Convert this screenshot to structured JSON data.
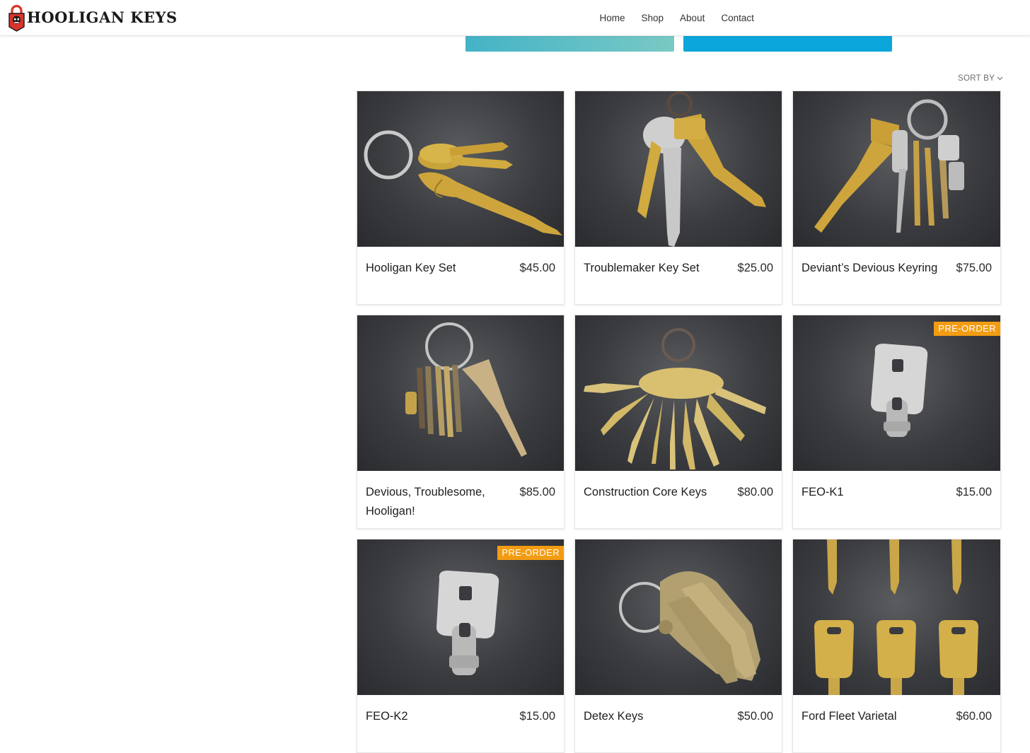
{
  "header": {
    "logo_text": "HOOLIGAN KEYS",
    "nav": [
      "Home",
      "Shop",
      "About",
      "Contact"
    ]
  },
  "toolbar": {
    "sort_label": "SORT BY",
    "sort_icon": "chevron-down-icon"
  },
  "colors": {
    "badge": "#f39c12",
    "cta_left": "#5cbec6",
    "cta_right": "#0aa6dc",
    "logo_red": "#d9342b"
  },
  "products": [
    {
      "name": "Hooligan Key Set",
      "price": "$45.00",
      "badge": ""
    },
    {
      "name": "Troublemaker Key Set",
      "price": "$25.00",
      "badge": ""
    },
    {
      "name": "Deviant’s Devious Keyring",
      "price": "$75.00",
      "badge": ""
    },
    {
      "name": "Devious, Troublesome, Hooligan!",
      "price": "$85.00",
      "badge": ""
    },
    {
      "name": "Construction Core Keys",
      "price": "$80.00",
      "badge": ""
    },
    {
      "name": "FEO-K1",
      "price": "$15.00",
      "badge": "PRE-ORDER"
    },
    {
      "name": "FEO-K2",
      "price": "$15.00",
      "badge": "PRE-ORDER"
    },
    {
      "name": "Detex Keys",
      "price": "$50.00",
      "badge": ""
    },
    {
      "name": "Ford Fleet Varietal",
      "price": "$60.00",
      "badge": ""
    }
  ]
}
